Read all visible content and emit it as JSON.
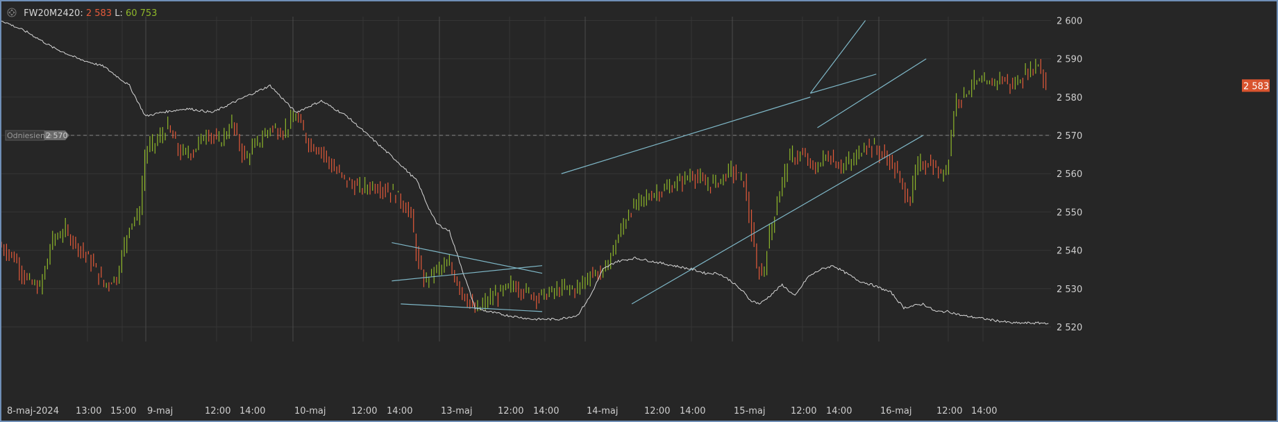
{
  "header": {
    "symbol": "FW20M2420",
    "price": "2 583",
    "volume_label": "L:",
    "volume": "60 753"
  },
  "reference": {
    "label": "Odniesienie",
    "value": "2 570"
  },
  "last_price_tag": "2 583",
  "colors": {
    "up": "#8fb82a",
    "down": "#e55a3a",
    "compare_line": "#d8d8d8",
    "trendline": "#7fb8c8",
    "grid": "#353535",
    "session_sep": "#4a4a4a",
    "frame": "#6f8fb7"
  },
  "chart_data": {
    "type": "line",
    "y_axis": {
      "ticks": [
        "2 600",
        "2 590",
        "2 580",
        "2 570",
        "2 560",
        "2 550",
        "2 540",
        "2 530",
        "2 520"
      ],
      "ylim": [
        2518,
        2601
      ]
    },
    "x_axis": {
      "labels": [
        "8-maj-2024",
        "13:00",
        "15:00",
        "9-maj",
        "12:00",
        "14:00",
        "10-maj",
        "12:00",
        "14:00",
        "13-maj",
        "12:00",
        "14:00",
        "14-maj",
        "12:00",
        "14:00",
        "15-maj",
        "12:00",
        "14:00",
        "16-maj",
        "12:00",
        "14:00"
      ]
    },
    "price_path": [
      [
        0,
        2541
      ],
      [
        20,
        2538
      ],
      [
        40,
        2532
      ],
      [
        60,
        2530
      ],
      [
        80,
        2543
      ],
      [
        100,
        2545
      ],
      [
        120,
        2541
      ],
      [
        140,
        2537
      ],
      [
        160,
        2531
      ],
      [
        180,
        2533
      ],
      [
        200,
        2547
      ],
      [
        215,
        2549
      ],
      [
        225,
        2566
      ],
      [
        240,
        2568
      ],
      [
        260,
        2572
      ],
      [
        280,
        2565
      ],
      [
        300,
        2566
      ],
      [
        320,
        2571
      ],
      [
        340,
        2568
      ],
      [
        360,
        2573
      ],
      [
        380,
        2564
      ],
      [
        400,
        2568
      ],
      [
        420,
        2572
      ],
      [
        440,
        2571
      ],
      [
        460,
        2575
      ],
      [
        480,
        2568
      ],
      [
        500,
        2566
      ],
      [
        520,
        2561
      ],
      [
        540,
        2558
      ],
      [
        560,
        2556
      ],
      [
        580,
        2557
      ],
      [
        600,
        2556
      ],
      [
        620,
        2554
      ],
      [
        640,
        2549
      ],
      [
        650,
        2537
      ],
      [
        660,
        2532
      ],
      [
        680,
        2535
      ],
      [
        700,
        2536
      ],
      [
        720,
        2529
      ],
      [
        740,
        2524
      ],
      [
        760,
        2527
      ],
      [
        780,
        2529
      ],
      [
        800,
        2531
      ],
      [
        820,
        2529
      ],
      [
        840,
        2528
      ],
      [
        860,
        2529
      ],
      [
        880,
        2530
      ],
      [
        900,
        2530
      ],
      [
        920,
        2534
      ],
      [
        940,
        2534
      ],
      [
        960,
        2542
      ],
      [
        980,
        2550
      ],
      [
        1000,
        2553
      ],
      [
        1020,
        2555
      ],
      [
        1040,
        2556
      ],
      [
        1060,
        2558
      ],
      [
        1080,
        2560
      ],
      [
        1100,
        2557
      ],
      [
        1120,
        2558
      ],
      [
        1140,
        2561
      ],
      [
        1160,
        2558
      ],
      [
        1170,
        2547
      ],
      [
        1180,
        2535
      ],
      [
        1190,
        2534
      ],
      [
        1200,
        2544
      ],
      [
        1215,
        2555
      ],
      [
        1230,
        2564
      ],
      [
        1250,
        2565
      ],
      [
        1270,
        2561
      ],
      [
        1290,
        2565
      ],
      [
        1310,
        2562
      ],
      [
        1330,
        2563
      ],
      [
        1350,
        2568
      ],
      [
        1370,
        2566
      ],
      [
        1390,
        2563
      ],
      [
        1410,
        2556
      ],
      [
        1420,
        2553
      ],
      [
        1430,
        2562
      ],
      [
        1450,
        2563
      ],
      [
        1470,
        2559
      ],
      [
        1480,
        2565
      ],
      [
        1490,
        2579
      ],
      [
        1505,
        2581
      ],
      [
        1520,
        2584
      ],
      [
        1540,
        2583
      ],
      [
        1560,
        2585
      ],
      [
        1580,
        2583
      ],
      [
        1600,
        2586
      ],
      [
        1620,
        2589
      ],
      [
        1632,
        2583
      ]
    ],
    "compare_path": [
      [
        0,
        2600
      ],
      [
        40,
        2597
      ],
      [
        80,
        2593
      ],
      [
        120,
        2590
      ],
      [
        160,
        2588
      ],
      [
        200,
        2583
      ],
      [
        225,
        2575
      ],
      [
        250,
        2576
      ],
      [
        290,
        2577
      ],
      [
        330,
        2576
      ],
      [
        380,
        2580
      ],
      [
        420,
        2583
      ],
      [
        460,
        2576
      ],
      [
        500,
        2579
      ],
      [
        540,
        2575
      ],
      [
        580,
        2569
      ],
      [
        620,
        2563
      ],
      [
        650,
        2558
      ],
      [
        665,
        2552
      ],
      [
        680,
        2547
      ],
      [
        700,
        2545
      ],
      [
        720,
        2535
      ],
      [
        740,
        2525
      ],
      [
        760,
        2524
      ],
      [
        790,
        2523
      ],
      [
        830,
        2522
      ],
      [
        870,
        2522
      ],
      [
        900,
        2523
      ],
      [
        920,
        2528
      ],
      [
        940,
        2535
      ],
      [
        960,
        2537
      ],
      [
        990,
        2538
      ],
      [
        1020,
        2537
      ],
      [
        1050,
        2536
      ],
      [
        1080,
        2535
      ],
      [
        1100,
        2534
      ],
      [
        1120,
        2534
      ],
      [
        1140,
        2532
      ],
      [
        1160,
        2529
      ],
      [
        1170,
        2527
      ],
      [
        1185,
        2526
      ],
      [
        1200,
        2528
      ],
      [
        1220,
        2531
      ],
      [
        1240,
        2528
      ],
      [
        1260,
        2533
      ],
      [
        1280,
        2535
      ],
      [
        1300,
        2536
      ],
      [
        1320,
        2534
      ],
      [
        1340,
        2532
      ],
      [
        1360,
        2531
      ],
      [
        1390,
        2529
      ],
      [
        1410,
        2525
      ],
      [
        1440,
        2526
      ],
      [
        1460,
        2524
      ],
      [
        1480,
        2524
      ],
      [
        1500,
        2523
      ],
      [
        1540,
        2522
      ],
      [
        1580,
        2521
      ],
      [
        1620,
        2521
      ],
      [
        1636,
        2521
      ]
    ],
    "trendlines": [
      [
        [
          610,
          2532
        ],
        [
          845,
          2536
        ]
      ],
      [
        [
          610,
          2542
        ],
        [
          845,
          2534
        ]
      ],
      [
        [
          624,
          2526
        ],
        [
          845,
          2524
        ]
      ],
      [
        [
          875,
          2560
        ],
        [
          1264,
          2580
        ]
      ],
      [
        [
          1264,
          2581
        ],
        [
          1350,
          2600
        ]
      ],
      [
        [
          985,
          2526
        ],
        [
          1440,
          2570
        ]
      ],
      [
        [
          1275,
          2572
        ],
        [
          1445,
          2590
        ]
      ],
      [
        [
          1264,
          2581
        ],
        [
          1367,
          2586
        ]
      ]
    ]
  }
}
